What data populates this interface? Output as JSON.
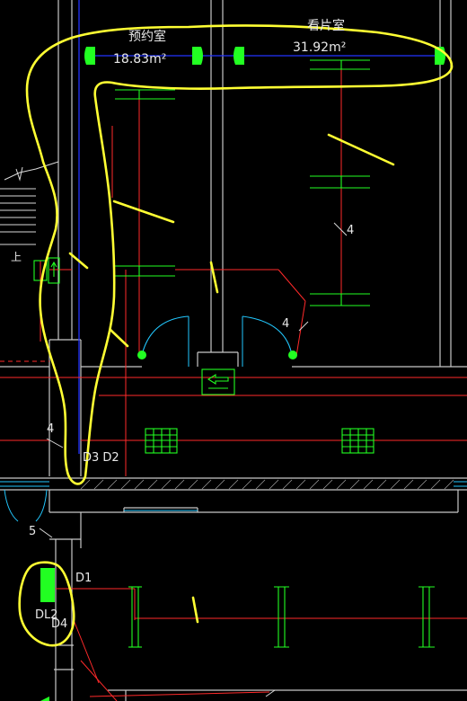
{
  "rooms": [
    {
      "name": "预约室",
      "area": "18.83m²"
    },
    {
      "name": "看片室",
      "area": "31.92m²"
    }
  ],
  "labels": {
    "dim_4_right": "4",
    "dim_4_door": "4",
    "dim_4_left": "4",
    "dim_5": "5",
    "d3_d2": "D3 D2",
    "d1": "D1",
    "dl2": "DL2",
    "d4": "D4",
    "stair_up": "上"
  },
  "colors": {
    "wall": "#c8c8c8",
    "pipe": "#ff2a2a",
    "fixture": "#22ff22",
    "annotation": "#ffff33",
    "door_arc": "#22c8ff",
    "axis": "#2233ff",
    "background": "#000000"
  }
}
